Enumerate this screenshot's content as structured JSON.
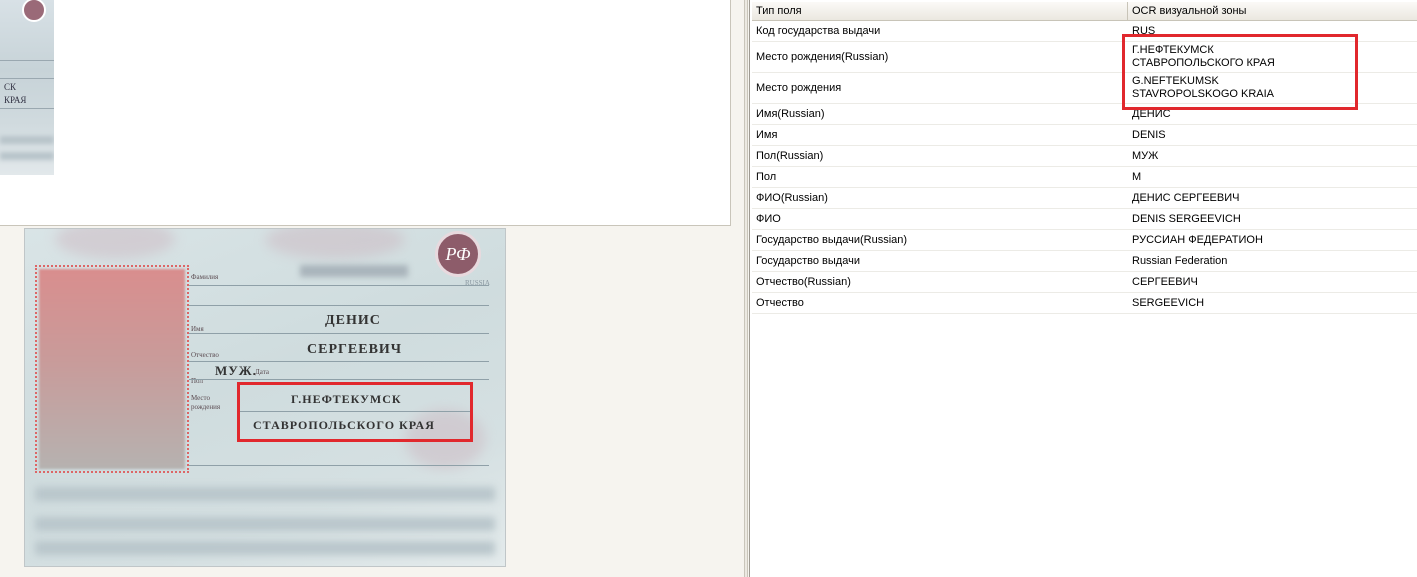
{
  "table": {
    "columns": [
      "Тип поля",
      "OCR визуальной зоны"
    ],
    "rows": [
      {
        "field": "Код государства выдачи",
        "value": [
          "RUS"
        ]
      },
      {
        "field": "Место рождения(Russian)",
        "value": [
          "Г.НЕФТЕКУМСК",
          "СТАВРОПОЛЬСКОГО КРАЯ"
        ]
      },
      {
        "field": "Место рождения",
        "value": [
          "G.NEFTEKUMSK",
          "STAVROPOLSKOGO KRAIA"
        ]
      },
      {
        "field": "Имя(Russian)",
        "value": [
          "ДЕНИС"
        ]
      },
      {
        "field": "Имя",
        "value": [
          "DENIS"
        ]
      },
      {
        "field": "Пол(Russian)",
        "value": [
          "МУЖ"
        ]
      },
      {
        "field": "Пол",
        "value": [
          "M"
        ]
      },
      {
        "field": "ФИО(Russian)",
        "value": [
          "ДЕНИС СЕРГЕЕВИЧ"
        ]
      },
      {
        "field": "ФИО",
        "value": [
          "DENIS SERGEEVICH"
        ]
      },
      {
        "field": "Государство выдачи(Russian)",
        "value": [
          "РУССИАН ФЕДЕРАТИОН"
        ]
      },
      {
        "field": "Государство выдачи",
        "value": [
          "Russian Federation"
        ]
      },
      {
        "field": "Отчество(Russian)",
        "value": [
          "СЕРГЕЕВИЧ"
        ]
      },
      {
        "field": "Отчество",
        "value": [
          "SERGEEVICH"
        ]
      }
    ]
  },
  "passport": {
    "labels": {
      "surname": "Фамилия",
      "name": "Имя",
      "patronymic": "Отчество",
      "sex": "Пол",
      "birth_date": "Дата",
      "birth_place_1": "Место",
      "birth_place_2": "рождения"
    },
    "values": {
      "name": "ДЕНИС",
      "patronymic": "СЕРГЕЕВИЧ",
      "sex": "МУЖ.",
      "birth_place_line1": "Г.НЕФТЕКУМСК",
      "birth_place_line2": "СТАВРОПОЛЬСКОГО КРАЯ"
    },
    "country_mark": "RUSSIA",
    "emblem_text": "РФ"
  },
  "thumbnail": {
    "lines": [
      "СК",
      "КРАЯ"
    ]
  },
  "colors": {
    "highlight": "#e1282d",
    "emblem": "#8d5c6a"
  }
}
